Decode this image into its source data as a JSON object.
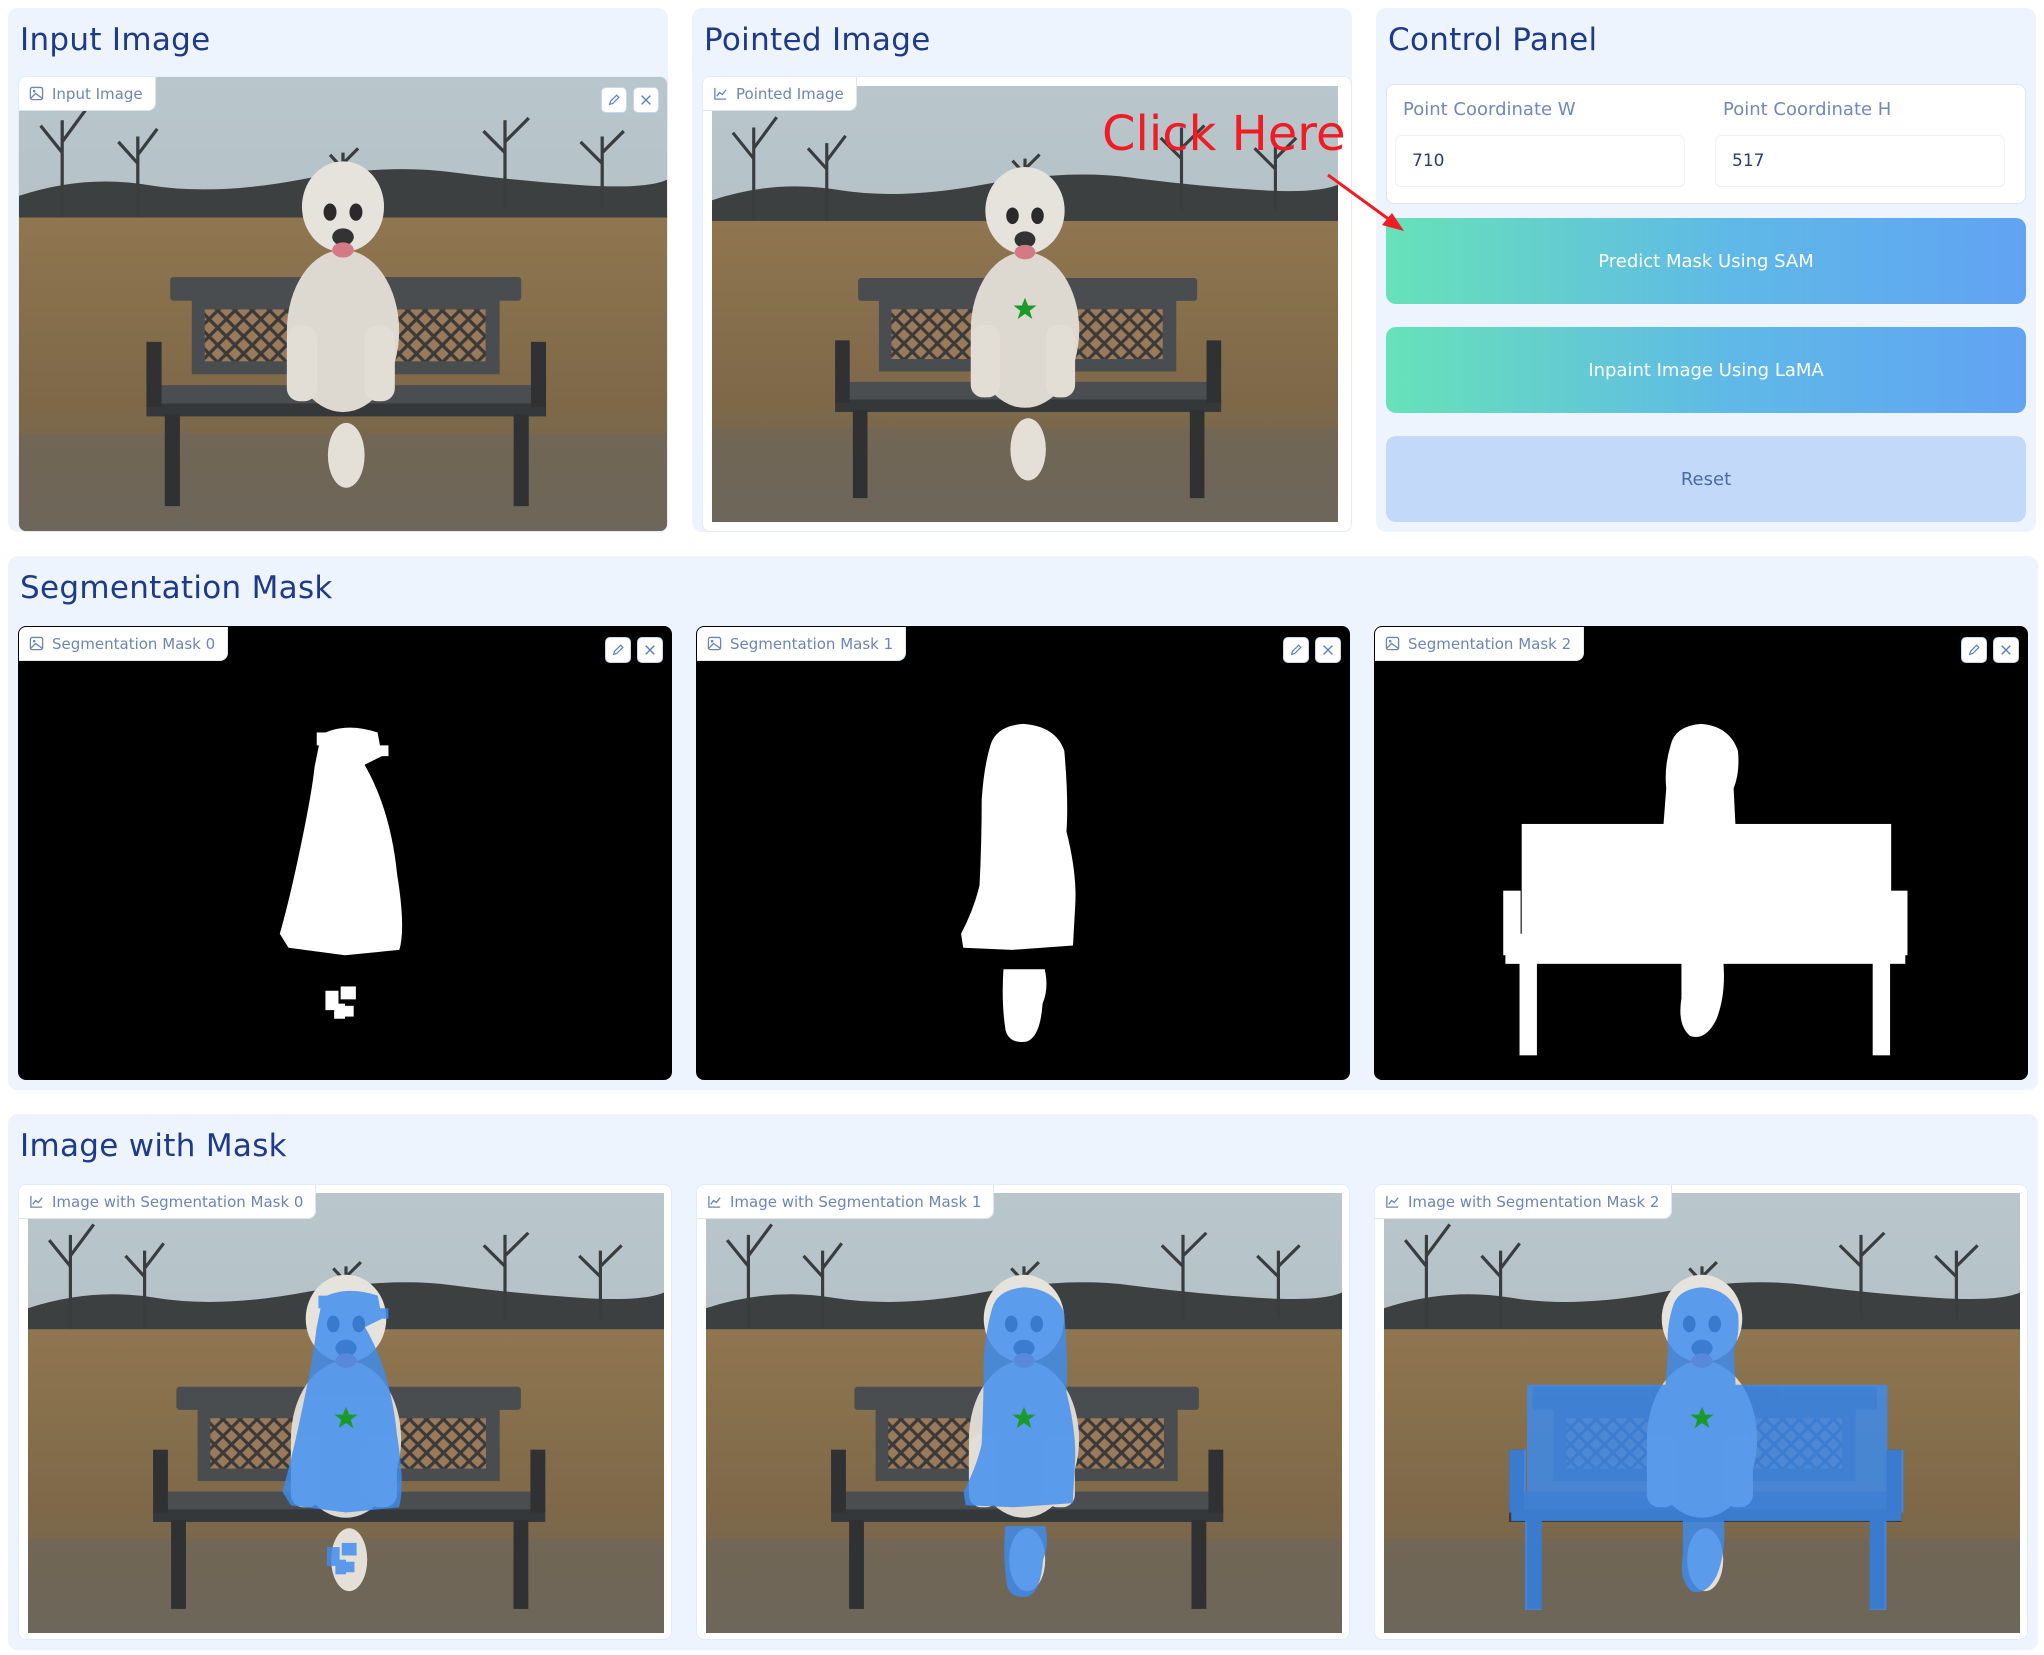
{
  "input_panel": {
    "title": "Input Image",
    "image_label": "Input Image"
  },
  "pointed_panel": {
    "title": "Pointed Image",
    "image_label": "Pointed Image",
    "annotation": "Click Here"
  },
  "control_panel": {
    "title": "Control Panel",
    "coord_w": {
      "label": "Point Coordinate W",
      "value": "710"
    },
    "coord_h": {
      "label": "Point Coordinate H",
      "value": "517"
    },
    "predict_button": "Predict Mask Using SAM",
    "inpaint_button": "Inpaint Image Using LaMA",
    "reset_button": "Reset"
  },
  "segmentation_panel": {
    "title": "Segmentation Mask",
    "masks": [
      {
        "label": "Segmentation Mask 0"
      },
      {
        "label": "Segmentation Mask 1"
      },
      {
        "label": "Segmentation Mask 2"
      }
    ]
  },
  "overlay_panel": {
    "title": "Image with Mask",
    "images": [
      {
        "label": "Image with Segmentation Mask 0"
      },
      {
        "label": "Image with Segmentation Mask 1"
      },
      {
        "label": "Image with Segmentation Mask 2"
      }
    ]
  },
  "colors": {
    "panel_bg": "#eef4fd",
    "title": "#1e3a8a",
    "mask_overlay": "#3d8cf0",
    "point_marker": "#1a9a2a",
    "annotation": "#ef1c24"
  },
  "icons": [
    "image-icon",
    "chart-icon",
    "edit-icon",
    "close-icon",
    "star-marker-icon"
  ]
}
